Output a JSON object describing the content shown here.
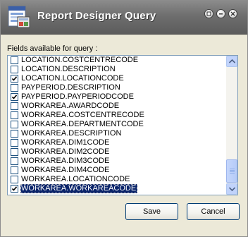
{
  "window": {
    "title": "Report Designer Query",
    "controls": [
      "restore-icon",
      "minimize-icon",
      "close-icon"
    ]
  },
  "fields_label": "Fields available for query :",
  "fields": [
    {
      "label": "LOCATION.COSTCENTRECODE",
      "checked": false,
      "selected": false
    },
    {
      "label": "LOCATION.DESCRIPTION",
      "checked": false,
      "selected": false
    },
    {
      "label": "LOCATION.LOCATIONCODE",
      "checked": true,
      "selected": false
    },
    {
      "label": "PAYPERIOD.DESCRIPTION",
      "checked": false,
      "selected": false
    },
    {
      "label": "PAYPERIOD.PAYPERIODCODE",
      "checked": true,
      "selected": false
    },
    {
      "label": "WORKAREA.AWARDCODE",
      "checked": false,
      "selected": false
    },
    {
      "label": "WORKAREA.COSTCENTRECODE",
      "checked": false,
      "selected": false
    },
    {
      "label": "WORKAREA.DEPARTMENTCODE",
      "checked": false,
      "selected": false
    },
    {
      "label": "WORKAREA.DESCRIPTION",
      "checked": false,
      "selected": false
    },
    {
      "label": "WORKAREA.DIM1CODE",
      "checked": false,
      "selected": false
    },
    {
      "label": "WORKAREA.DIM2CODE",
      "checked": false,
      "selected": false
    },
    {
      "label": "WORKAREA.DIM3CODE",
      "checked": false,
      "selected": false
    },
    {
      "label": "WORKAREA.DIM4CODE",
      "checked": false,
      "selected": false
    },
    {
      "label": "WORKAREA.LOCATIONCODE",
      "checked": false,
      "selected": false
    },
    {
      "label": "WORKAREA.WORKAREACODE",
      "checked": true,
      "selected": true
    }
  ],
  "buttons": {
    "save": "Save",
    "cancel": "Cancel"
  },
  "colors": {
    "title_bar": "#6e6e6e",
    "selection": "#0a246a",
    "list_border": "#7f9db9",
    "button_border": "#003c74"
  }
}
